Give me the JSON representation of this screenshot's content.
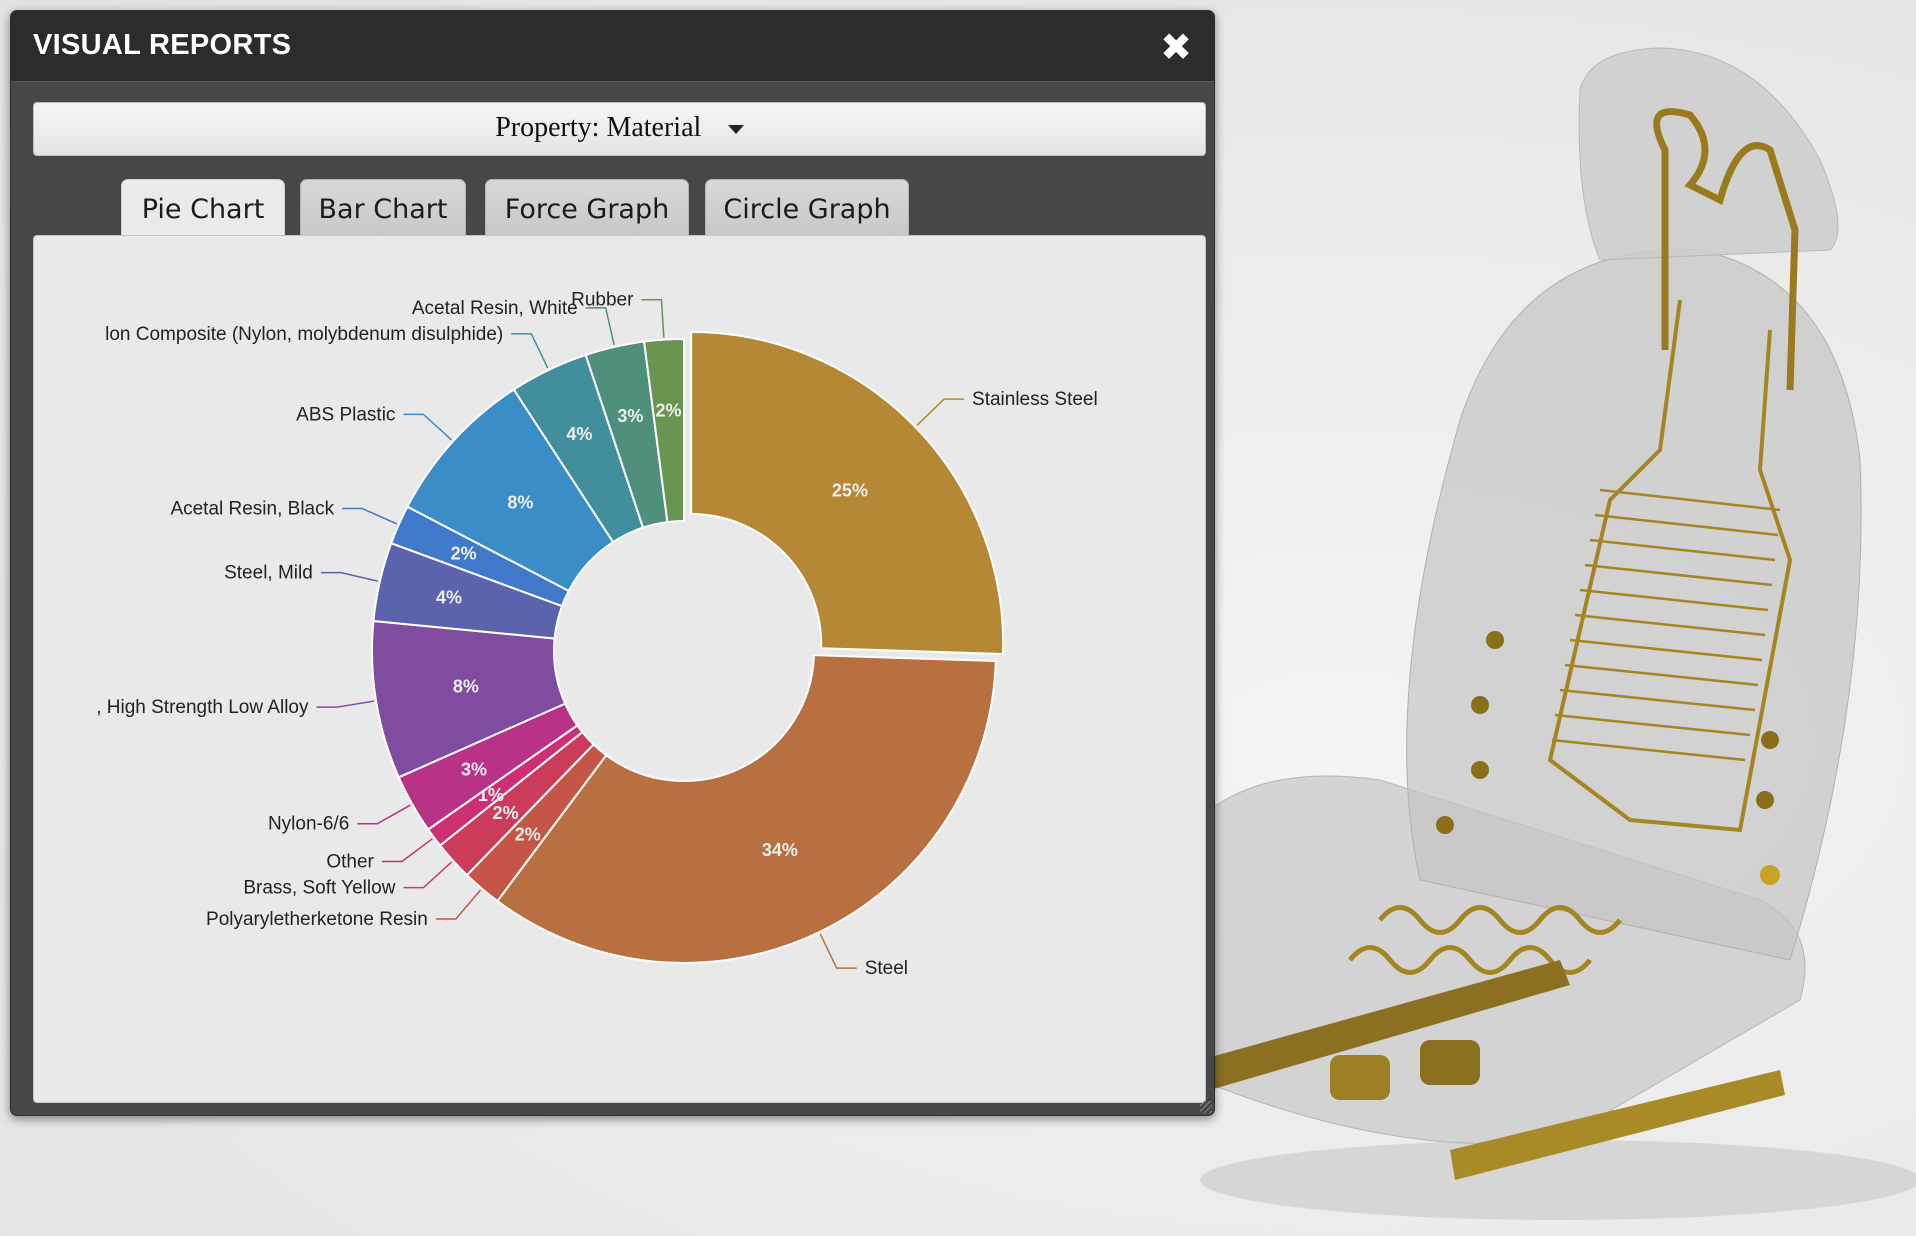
{
  "panel": {
    "title": "VISUAL REPORTS",
    "close_icon": "close-icon",
    "property_select": {
      "value": "Property: Material",
      "icon": "caret-down-icon"
    }
  },
  "tabs": [
    {
      "label": "Pie Chart",
      "active": true
    },
    {
      "label": "Bar Chart",
      "active": false
    },
    {
      "label": "Force Graph",
      "active": false
    },
    {
      "label": "Circle Graph",
      "active": false
    }
  ],
  "chart_data": {
    "type": "pie",
    "donut": true,
    "slices": [
      {
        "name": "Stainless Steel",
        "percent": 25,
        "label": "25%",
        "color": "#b48834"
      },
      {
        "name": "Steel",
        "percent": 34,
        "label": "34%",
        "color": "#b87041"
      },
      {
        "name": "Polyaryletherketone Resin",
        "percent": 2,
        "label": "2%",
        "color": "#c55546"
      },
      {
        "name": "Brass, Soft Yellow",
        "percent": 2,
        "label": "2%",
        "color": "#cb3c5a"
      },
      {
        "name": "Other",
        "percent": 1,
        "label": "1%",
        "color": "#cc2f72"
      },
      {
        "name": "Nylon-6/6",
        "percent": 3,
        "label": "3%",
        "color": "#b83288"
      },
      {
        "name": ", High Strength Low Alloy",
        "percent": 8,
        "label": "8%",
        "color": "#7f4c9f"
      },
      {
        "name": "Steel, Mild",
        "percent": 4,
        "label": "4%",
        "color": "#5c63ad"
      },
      {
        "name": "Acetal Resin, Black",
        "percent": 2,
        "label": "2%",
        "color": "#4079c9"
      },
      {
        "name": "ABS Plastic",
        "percent": 8,
        "label": "8%",
        "color": "#3a8dc6"
      },
      {
        "name": "lon Composite (Nylon, molybdenum disulphide)",
        "percent": 4,
        "label": "4%",
        "color": "#428e9c"
      },
      {
        "name": "Acetal Resin, White",
        "percent": 3,
        "label": "3%",
        "color": "#4e907b"
      },
      {
        "name": "Rubber",
        "percent": 2,
        "label": "2%",
        "color": "#6a9551"
      }
    ]
  },
  "viewer": {
    "model": "car-seat-3d-model"
  }
}
